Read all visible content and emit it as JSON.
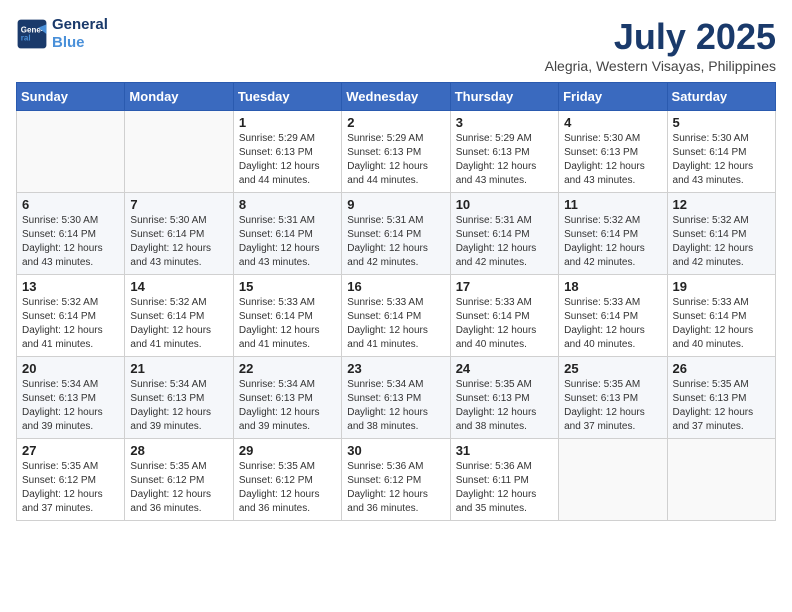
{
  "header": {
    "logo_line1": "General",
    "logo_line2": "Blue",
    "month_title": "July 2025",
    "location": "Alegria, Western Visayas, Philippines"
  },
  "days_of_week": [
    "Sunday",
    "Monday",
    "Tuesday",
    "Wednesday",
    "Thursday",
    "Friday",
    "Saturday"
  ],
  "weeks": [
    [
      {
        "day": "",
        "info": ""
      },
      {
        "day": "",
        "info": ""
      },
      {
        "day": "1",
        "info": "Sunrise: 5:29 AM\nSunset: 6:13 PM\nDaylight: 12 hours\nand 44 minutes."
      },
      {
        "day": "2",
        "info": "Sunrise: 5:29 AM\nSunset: 6:13 PM\nDaylight: 12 hours\nand 44 minutes."
      },
      {
        "day": "3",
        "info": "Sunrise: 5:29 AM\nSunset: 6:13 PM\nDaylight: 12 hours\nand 43 minutes."
      },
      {
        "day": "4",
        "info": "Sunrise: 5:30 AM\nSunset: 6:13 PM\nDaylight: 12 hours\nand 43 minutes."
      },
      {
        "day": "5",
        "info": "Sunrise: 5:30 AM\nSunset: 6:14 PM\nDaylight: 12 hours\nand 43 minutes."
      }
    ],
    [
      {
        "day": "6",
        "info": "Sunrise: 5:30 AM\nSunset: 6:14 PM\nDaylight: 12 hours\nand 43 minutes."
      },
      {
        "day": "7",
        "info": "Sunrise: 5:30 AM\nSunset: 6:14 PM\nDaylight: 12 hours\nand 43 minutes."
      },
      {
        "day": "8",
        "info": "Sunrise: 5:31 AM\nSunset: 6:14 PM\nDaylight: 12 hours\nand 43 minutes."
      },
      {
        "day": "9",
        "info": "Sunrise: 5:31 AM\nSunset: 6:14 PM\nDaylight: 12 hours\nand 42 minutes."
      },
      {
        "day": "10",
        "info": "Sunrise: 5:31 AM\nSunset: 6:14 PM\nDaylight: 12 hours\nand 42 minutes."
      },
      {
        "day": "11",
        "info": "Sunrise: 5:32 AM\nSunset: 6:14 PM\nDaylight: 12 hours\nand 42 minutes."
      },
      {
        "day": "12",
        "info": "Sunrise: 5:32 AM\nSunset: 6:14 PM\nDaylight: 12 hours\nand 42 minutes."
      }
    ],
    [
      {
        "day": "13",
        "info": "Sunrise: 5:32 AM\nSunset: 6:14 PM\nDaylight: 12 hours\nand 41 minutes."
      },
      {
        "day": "14",
        "info": "Sunrise: 5:32 AM\nSunset: 6:14 PM\nDaylight: 12 hours\nand 41 minutes."
      },
      {
        "day": "15",
        "info": "Sunrise: 5:33 AM\nSunset: 6:14 PM\nDaylight: 12 hours\nand 41 minutes."
      },
      {
        "day": "16",
        "info": "Sunrise: 5:33 AM\nSunset: 6:14 PM\nDaylight: 12 hours\nand 41 minutes."
      },
      {
        "day": "17",
        "info": "Sunrise: 5:33 AM\nSunset: 6:14 PM\nDaylight: 12 hours\nand 40 minutes."
      },
      {
        "day": "18",
        "info": "Sunrise: 5:33 AM\nSunset: 6:14 PM\nDaylight: 12 hours\nand 40 minutes."
      },
      {
        "day": "19",
        "info": "Sunrise: 5:33 AM\nSunset: 6:14 PM\nDaylight: 12 hours\nand 40 minutes."
      }
    ],
    [
      {
        "day": "20",
        "info": "Sunrise: 5:34 AM\nSunset: 6:13 PM\nDaylight: 12 hours\nand 39 minutes."
      },
      {
        "day": "21",
        "info": "Sunrise: 5:34 AM\nSunset: 6:13 PM\nDaylight: 12 hours\nand 39 minutes."
      },
      {
        "day": "22",
        "info": "Sunrise: 5:34 AM\nSunset: 6:13 PM\nDaylight: 12 hours\nand 39 minutes."
      },
      {
        "day": "23",
        "info": "Sunrise: 5:34 AM\nSunset: 6:13 PM\nDaylight: 12 hours\nand 38 minutes."
      },
      {
        "day": "24",
        "info": "Sunrise: 5:35 AM\nSunset: 6:13 PM\nDaylight: 12 hours\nand 38 minutes."
      },
      {
        "day": "25",
        "info": "Sunrise: 5:35 AM\nSunset: 6:13 PM\nDaylight: 12 hours\nand 37 minutes."
      },
      {
        "day": "26",
        "info": "Sunrise: 5:35 AM\nSunset: 6:13 PM\nDaylight: 12 hours\nand 37 minutes."
      }
    ],
    [
      {
        "day": "27",
        "info": "Sunrise: 5:35 AM\nSunset: 6:12 PM\nDaylight: 12 hours\nand 37 minutes."
      },
      {
        "day": "28",
        "info": "Sunrise: 5:35 AM\nSunset: 6:12 PM\nDaylight: 12 hours\nand 36 minutes."
      },
      {
        "day": "29",
        "info": "Sunrise: 5:35 AM\nSunset: 6:12 PM\nDaylight: 12 hours\nand 36 minutes."
      },
      {
        "day": "30",
        "info": "Sunrise: 5:36 AM\nSunset: 6:12 PM\nDaylight: 12 hours\nand 36 minutes."
      },
      {
        "day": "31",
        "info": "Sunrise: 5:36 AM\nSunset: 6:11 PM\nDaylight: 12 hours\nand 35 minutes."
      },
      {
        "day": "",
        "info": ""
      },
      {
        "day": "",
        "info": ""
      }
    ]
  ]
}
